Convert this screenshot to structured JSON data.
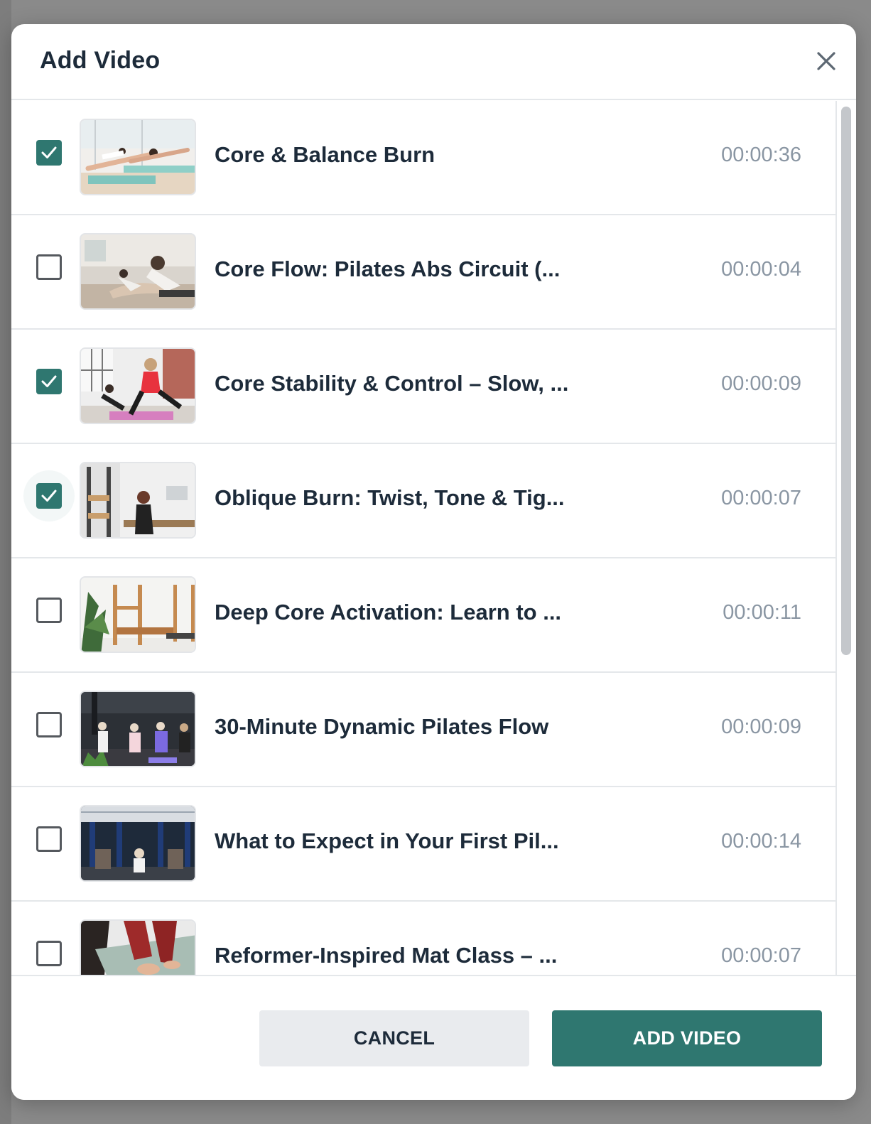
{
  "modal": {
    "title": "Add Video",
    "close_label": "close"
  },
  "videos": [
    {
      "title": "Core & Balance Burn",
      "duration": "00:00:36",
      "checked": true
    },
    {
      "title": "Core Flow: Pilates Abs Circuit (...",
      "duration": "00:00:04",
      "checked": false
    },
    {
      "title": "Core Stability & Control – Slow, ...",
      "duration": "00:00:09",
      "checked": true
    },
    {
      "title": "Oblique Burn: Twist, Tone & Tig...",
      "duration": "00:00:07",
      "checked": true
    },
    {
      "title": "Deep Core Activation: Learn to ...",
      "duration": "00:00:11",
      "checked": false
    },
    {
      "title": "30-Minute Dynamic Pilates Flow",
      "duration": "00:00:09",
      "checked": false
    },
    {
      "title": "What to Expect in Your First Pil...",
      "duration": "00:00:14",
      "checked": false
    },
    {
      "title": "Reformer-Inspired Mat Class – ...",
      "duration": "00:00:07",
      "checked": false
    }
  ],
  "footer": {
    "cancel_label": "CANCEL",
    "add_label": "ADD VIDEO"
  },
  "colors": {
    "accent": "#2f7770",
    "title_text": "#1d2b3a",
    "duration_text": "#8a96a3",
    "divider": "#e4e7ea",
    "overlay": "#8a8a8a"
  },
  "icons": {
    "close": "close-icon",
    "check": "checkmark-icon"
  }
}
